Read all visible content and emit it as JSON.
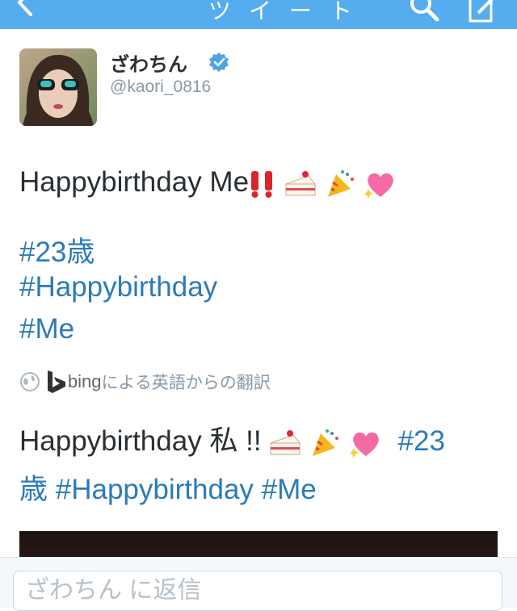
{
  "navbar": {
    "title_fragment": "ツイート"
  },
  "profile": {
    "display_name": "ざわちん",
    "username": "@kaori_0816"
  },
  "tweet": {
    "line1_text": "Happybirthday Me",
    "hashtags": [
      "#23歳",
      "#Happybirthday",
      "#Me"
    ]
  },
  "translation": {
    "provider": "bing",
    "credit": "による英語からの翻訳",
    "text_main": "Happybirthday 私 !! ",
    "tag1": "#23",
    "tag2_prefix": "歳",
    "tag3": "#Happybirthday",
    "tag4": "#Me"
  },
  "reply": {
    "placeholder": "ざわちん に返信"
  },
  "colors": {
    "brand": "#55acee",
    "hashtag": "#2b7bb9",
    "verified": "#4ba3e8"
  }
}
